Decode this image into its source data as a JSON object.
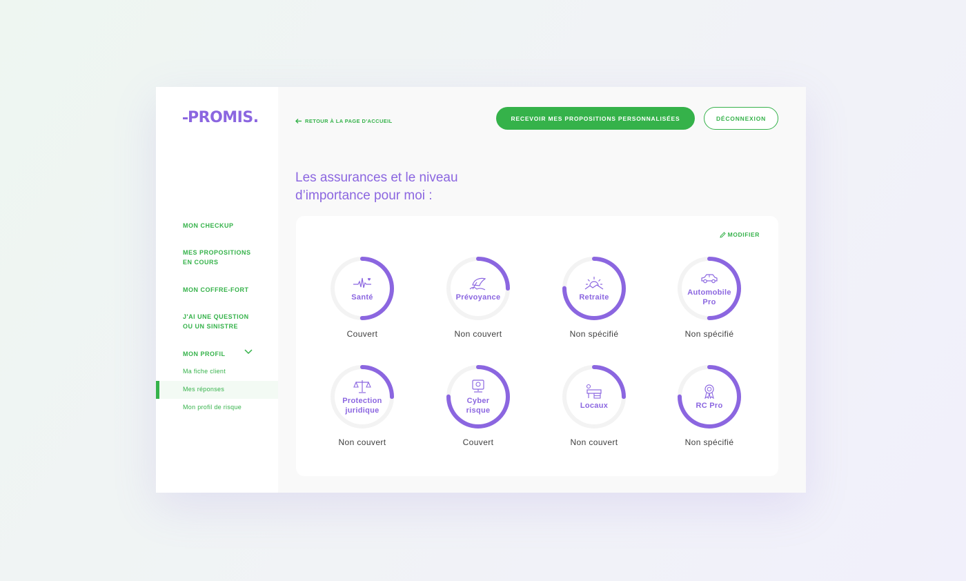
{
  "brand": {
    "logo_text": "PROMIS.",
    "primary_color": "#8b66e0",
    "accent_color": "#35b24a"
  },
  "sidebar": {
    "items": [
      {
        "label": "MON CHECKUP"
      },
      {
        "label": "MES PROPOSITIONS",
        "label2": "EN COURS"
      },
      {
        "label": "MON COFFRE-FORT"
      },
      {
        "label": "J'AI UNE QUESTION",
        "label2": "OU UN SINISTRE"
      },
      {
        "label": "MON PROFIL",
        "expanded": true
      }
    ],
    "sub_items": [
      {
        "label": "Ma fiche client"
      },
      {
        "label": "Mes réponses",
        "active": true
      },
      {
        "label": "Mon profil de risque"
      }
    ]
  },
  "header": {
    "back_label": "RETOUR À LA PAGE D'ACCUEIL",
    "primary_button": "RECEVOIR MES PROPOSITIONS PERSONNALISÉES",
    "logout_button": "DÉCONNEXION"
  },
  "main": {
    "title_line1": "Les assurances et le niveau",
    "title_line2": "d’importance pour moi :",
    "modify_label": "MODIFIER",
    "insurances": [
      {
        "label": "Santé",
        "status": "Couvert",
        "icon": "heartbeat-icon",
        "importance": 0.5
      },
      {
        "label": "Prévoyance",
        "status": "Non couvert",
        "icon": "umbrella-icon",
        "importance": 0.25
      },
      {
        "label": "Retraite",
        "status": "Non spécifié",
        "icon": "sunset-icon",
        "importance": 0.75
      },
      {
        "label": "Automobile Pro",
        "label_line1": "Automobile",
        "label_line2": "Pro",
        "status": "Non spécifié",
        "icon": "car-icon",
        "importance": 0.5
      },
      {
        "label": "Protection juridique",
        "label_line1": "Protection",
        "label_line2": "juridique",
        "status": "Non couvert",
        "icon": "scales-icon",
        "importance": 0.25
      },
      {
        "label": "Cyber risque",
        "label_line1": "Cyber",
        "label_line2": "risque",
        "status": "Couvert",
        "icon": "computer-icon",
        "importance": 0.75
      },
      {
        "label": "Locaux",
        "status": "Non couvert",
        "icon": "office-icon",
        "importance": 0.25
      },
      {
        "label": "RC Pro",
        "status": "Non spécifié",
        "icon": "award-icon",
        "importance": 0.75
      }
    ]
  }
}
